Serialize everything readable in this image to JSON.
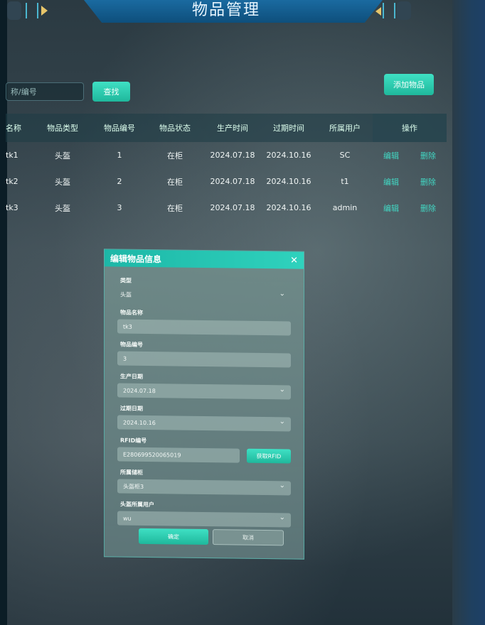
{
  "header": {
    "title": "物品管理"
  },
  "toolbar": {
    "search_placeholder": "称/编号",
    "search_label": "查找",
    "add_label": "添加物品"
  },
  "table": {
    "columns": [
      "名称",
      "物品类型",
      "物品编号",
      "物品状态",
      "生产时间",
      "过期时间",
      "所属用户",
      "操作"
    ],
    "rows": [
      {
        "name": "tk1",
        "type": "头盔",
        "code": "1",
        "status": "在柜",
        "produced": "2024.07.18",
        "expires": "2024.10.16",
        "user": "SC",
        "edit": "编辑",
        "del": "删除"
      },
      {
        "name": "tk2",
        "type": "头盔",
        "code": "2",
        "status": "在柜",
        "produced": "2024.07.18",
        "expires": "2024.10.16",
        "user": "t1",
        "edit": "编辑",
        "del": "删除"
      },
      {
        "name": "tk3",
        "type": "头盔",
        "code": "3",
        "status": "在柜",
        "produced": "2024.07.18",
        "expires": "2024.10.16",
        "user": "admin",
        "edit": "编辑",
        "del": "删除"
      }
    ]
  },
  "modal": {
    "title": "编辑物品信息",
    "close": "✕",
    "fields": {
      "type_label": "类型",
      "type_value": "头盔",
      "name_label": "物品名称",
      "name_value": "tk3",
      "code_label": "物品编号",
      "code_value": "3",
      "produced_label": "生产日期",
      "produced_value": "2024.07.18",
      "expires_label": "过期日期",
      "expires_value": "2024.10.16",
      "rfid_label": "RFID编号",
      "rfid_value": "E280699520065019",
      "rfid_button": "获取RFID",
      "cabinet_label": "所属储柜",
      "cabinet_value": "头盔柜3",
      "owner_label": "头盔所属用户",
      "owner_value": "wu"
    },
    "ok_label": "确定",
    "cancel_label": "取消"
  },
  "colors": {
    "accent": "#2fd2bd",
    "header_bar": "#1a6aa0",
    "back_arrow": "#e7c56a"
  }
}
